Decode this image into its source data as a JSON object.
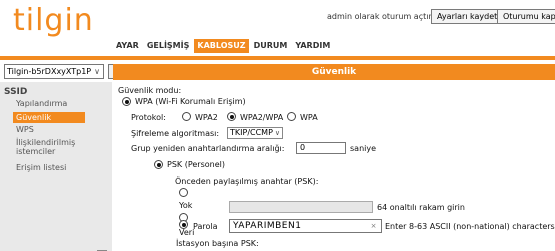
{
  "brand": {
    "logo_text": "tilgin"
  },
  "header": {
    "status_text": "admin olarak oturum açtınız.",
    "save_button": "Ayarları kaydet",
    "logout_button": "Oturumu kapat"
  },
  "tabs": [
    {
      "label": "AYAR"
    },
    {
      "label": "GELİŞMİŞ"
    },
    {
      "label": "KABLOSUZ"
    },
    {
      "label": "DURUM"
    },
    {
      "label": "YARDIM"
    }
  ],
  "active_tab": "KABLOSUZ",
  "network": {
    "selected": "Tilgin-b5rDXxyXTp1P",
    "go_button": "Git"
  },
  "section_title": "Güvenlik",
  "sidebar": {
    "title": "SSID",
    "items": [
      {
        "label": "Yapılandırma"
      },
      {
        "label": "Güvenlik"
      },
      {
        "label": "WPS"
      },
      {
        "label": "İlişkilendirilmiş istemciler"
      },
      {
        "label": "Erişim listesi"
      }
    ],
    "active_item": "Güvenlik"
  },
  "security": {
    "mode_label": "Güvenlik modu:",
    "wpa_label": "WPA (Wi-Fi Korumalı Erişim)",
    "protocol_label": "Protokol:",
    "protocol_options": [
      "WPA2",
      "WPA2/WPA",
      "WPA"
    ],
    "protocol_selected": "WPA2/WPA",
    "cipher_label": "Şifreleme algoritması:",
    "cipher_value": "TKIP/CCMP",
    "rekey_label": "Grup yeniden anahtarlandırma aralığı:",
    "rekey_value": "0",
    "rekey_unit": "saniye",
    "psk_label": "PSK (Personel)",
    "preshared_label": "Önceden paylaşılmış anahtar (PSK):",
    "options": {
      "none": "Yok",
      "data": "Veri",
      "password": "Parola"
    },
    "hex_hint": "64 onaltılı rakam girin",
    "password_value": "YAPARIMBEN1",
    "password_hint": "Enter 8-63 ASCII (non-national) characters",
    "per_station_label": "İstasyon başına PSK:"
  },
  "colors": {
    "accent": "#f28a1f",
    "sidebar_bg": "#e9e9e9"
  }
}
